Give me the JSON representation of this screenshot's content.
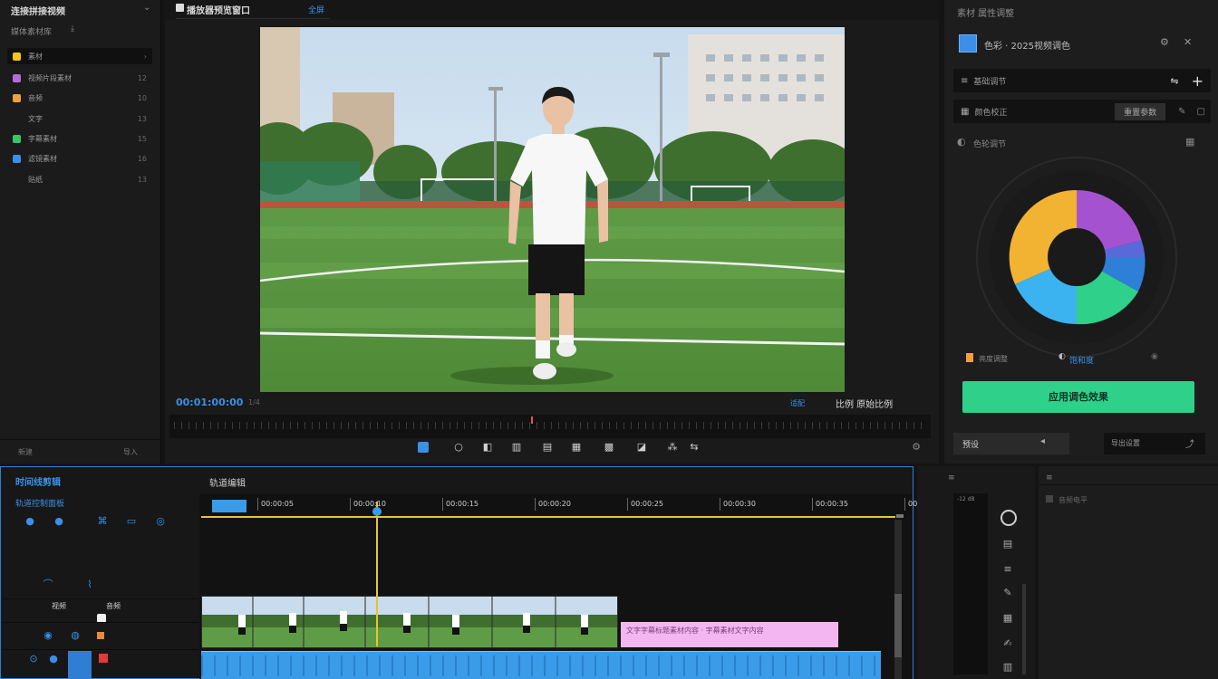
{
  "media": {
    "title": "连接拼接视频",
    "subtitle": "媒体素材库",
    "items": [
      {
        "label": "素材",
        "count": "5",
        "color": "#f5c518"
      },
      {
        "label": "视频片段素材",
        "count": "12",
        "color": "#b86bd6"
      },
      {
        "label": "音频",
        "count": "10",
        "color": "#f0a040"
      },
      {
        "label": "文字",
        "count": "13",
        "color": ""
      },
      {
        "label": "字幕素材",
        "count": "15",
        "color": "#39c46a"
      },
      {
        "label": "滤镜素材",
        "count": "16",
        "color": "#3b8fe8"
      },
      {
        "label": "贴纸",
        "count": "13",
        "color": ""
      }
    ],
    "footer_left": "新建",
    "footer_right": "导入"
  },
  "preview": {
    "tab_title": "播放器预览窗口",
    "tab_right": "全屏",
    "timecode": "00:01:00:00",
    "timecode_small": "1/4",
    "timecode_suffix": "适配",
    "right_label": "比例 原始比例",
    "controls": [
      "play",
      "stop",
      "prev",
      "rewind",
      "forward",
      "next",
      "loop",
      "snapshot",
      "fullscreen"
    ]
  },
  "props": {
    "title": "素材 属性调整",
    "layer_name": "色彩 · 2025视频调色",
    "row1_label": "基础调节",
    "row2_label": "颜色校正",
    "row2_button": "重置参数",
    "wheel_label": "色轮调节",
    "opt_left": "亮度调整",
    "opt_right": "饱和度",
    "apply_button": "应用调色效果",
    "bottom_left": "预设",
    "bottom_right": "导出设置"
  },
  "timeline": {
    "title": "时间线剪辑",
    "subtitle": "轨道控制面板",
    "ruler_title": "轨道编辑",
    "ruler_ticks": [
      "00:00:00",
      "00:00:05",
      "00:00:10",
      "00:00:15",
      "00:00:20",
      "00:00:25",
      "00:00:30",
      "00:00:35",
      "00:00:40",
      "00:00:45"
    ],
    "text_clip": "文字字幕标题素材内容 · 字幕素材文字内容",
    "track_label_1": "视频",
    "track_label_2": "音频"
  },
  "right_lower": {
    "title": "音频电平",
    "meter_value": "-12 dB"
  },
  "colors": {
    "accent": "#2e7fd4",
    "green_button": "#2fd18a",
    "text_clip": "#f3b6f0",
    "audio_clip": "#3a9be8"
  }
}
